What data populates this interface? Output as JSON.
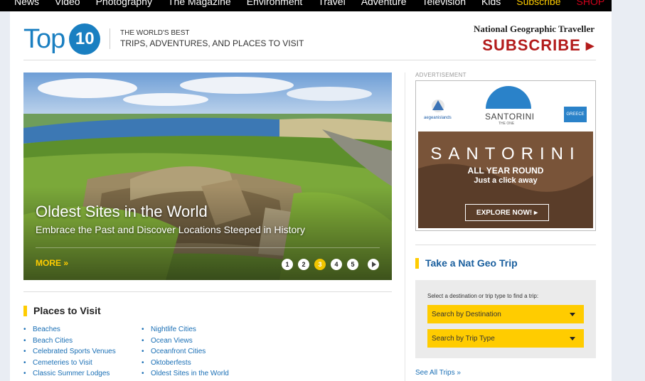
{
  "nav": {
    "items": [
      "News",
      "Video",
      "Photography",
      "The Magazine",
      "Environment",
      "Travel",
      "Adventure",
      "Television",
      "Kids"
    ],
    "subscribe": "Subscribe",
    "shop": "SHOP"
  },
  "header": {
    "logo_text": "Top",
    "logo_number": "10",
    "tagline_line1": "THE WORLD'S BEST",
    "tagline_line2": "TRIPS, ADVENTURES, AND PLACES TO VISIT",
    "brand": "National Geographic Traveller",
    "subscribe": "SUBSCRIBE ▸"
  },
  "hero": {
    "title": "Oldest Sites in the World",
    "subtitle": "Embrace the Past and Discover Locations Steeped in History",
    "more": "MORE »",
    "slides": [
      "1",
      "2",
      "3",
      "4",
      "5"
    ],
    "active_slide": 3
  },
  "places": {
    "heading": "Places to Visit",
    "col1": [
      "Beaches",
      "Beach Cities",
      "Celebrated Sports Venues",
      "Cemeteries to Visit",
      "Classic Summer Lodges"
    ],
    "col2": [
      "Nightlife Cities",
      "Ocean Views",
      "Oceanfront Cities",
      "Oktoberfests",
      "Oldest Sites in the World"
    ]
  },
  "ad": {
    "label": "ADVERTISEMENT",
    "sponsor": "aegeanislands",
    "brand_small": "SANTORINI",
    "brand_sub": "THE ONE",
    "greece": "GREECE",
    "headline": "SANTORINI",
    "line1": "ALL YEAR ROUND",
    "line2": "Just a click away",
    "button": "EXPLORE NOW! ▸"
  },
  "trip": {
    "heading": "Take a Nat Geo Trip",
    "hint": "Select a destination or trip type to find a trip:",
    "dest_select": "Search by Destination",
    "type_select": "Search by Trip Type",
    "see_all": "See All Trips »"
  },
  "colors": {
    "accent_blue": "#1a7fc1",
    "subscribe_red": "#b31b1b",
    "highlight_yellow": "#ffcc00"
  }
}
